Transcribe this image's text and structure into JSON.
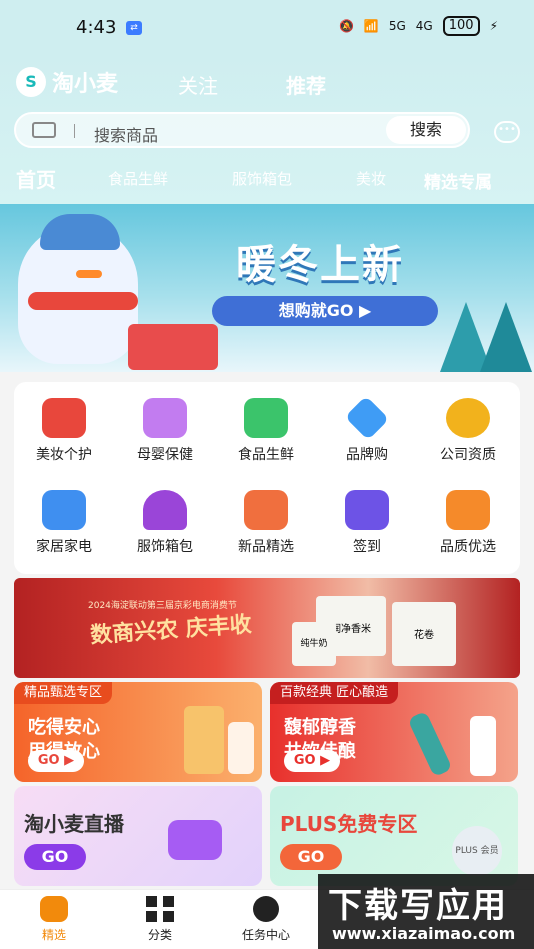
{
  "status_bar": {
    "time": "4:43",
    "network": "5G",
    "network2": "4G",
    "battery": "100"
  },
  "header": {
    "logo_text": "淘小麦",
    "tabs": [
      "关注",
      "推荐"
    ],
    "search": {
      "placeholder": "搜索商品",
      "button": "搜索"
    }
  },
  "categories": [
    "首页",
    "食品生鲜",
    "服饰箱包",
    "美妆",
    "精选专属"
  ],
  "banner": {
    "title": "暖冬上新",
    "subtitle": "想购就GO ▶"
  },
  "grid": [
    {
      "label": "美妆个护",
      "icon": "lipstick-icon",
      "color": "#e8473c"
    },
    {
      "label": "母婴保健",
      "icon": "baby-food-icon",
      "color": "#c27cf0"
    },
    {
      "label": "食品生鲜",
      "icon": "vegetable-basket-icon",
      "color": "#3bc46b"
    },
    {
      "label": "品牌购",
      "icon": "diamond-icon",
      "color": "#3f9cf5"
    },
    {
      "label": "公司资质",
      "icon": "badge-icon",
      "color": "#f2b21c"
    },
    {
      "label": "家居家电",
      "icon": "sofa-icon",
      "color": "#3f8ff0"
    },
    {
      "label": "服饰箱包",
      "icon": "dress-icon",
      "color": "#9a45d8"
    },
    {
      "label": "新品精选",
      "icon": "gift-box-icon",
      "color": "#f06f3e"
    },
    {
      "label": "签到",
      "icon": "calendar-star-icon",
      "color": "#6d53e6"
    },
    {
      "label": "品质优选",
      "icon": "package-icon",
      "color": "#f58a2a"
    }
  ],
  "promo": {
    "subtitle": "2024海淀联动第三届京彩电商消费节",
    "title": "数商兴农 庆丰收",
    "products": [
      "润净香米",
      "纯牛奶",
      "花卷"
    ]
  },
  "cards": [
    {
      "tag": "精品甄选专区",
      "line1": "吃得安心",
      "line2": "用得放心",
      "go": "GO ▶"
    },
    {
      "tag": "百款经典 匠心酿造",
      "line1": "馥郁醇香",
      "line2": "共饮佳酿",
      "go": "GO ▶"
    }
  ],
  "live": {
    "title": "淘小麦直播",
    "go": "GO"
  },
  "plus": {
    "title": "PLUS免费专区",
    "go": "GO",
    "badge": "PLUS 会员"
  },
  "bottom_nav": [
    {
      "label": "精选",
      "icon": "home-icon",
      "active": true
    },
    {
      "label": "分类",
      "icon": "grid-icon",
      "active": false
    },
    {
      "label": "任务中心",
      "icon": "task-logo-icon",
      "active": false
    }
  ],
  "watermark": {
    "text": "下载写应用",
    "url": "www.xiazaimao.com"
  },
  "colors": {
    "accent": "#19b9b9",
    "active_nav": "#f28a0c"
  }
}
